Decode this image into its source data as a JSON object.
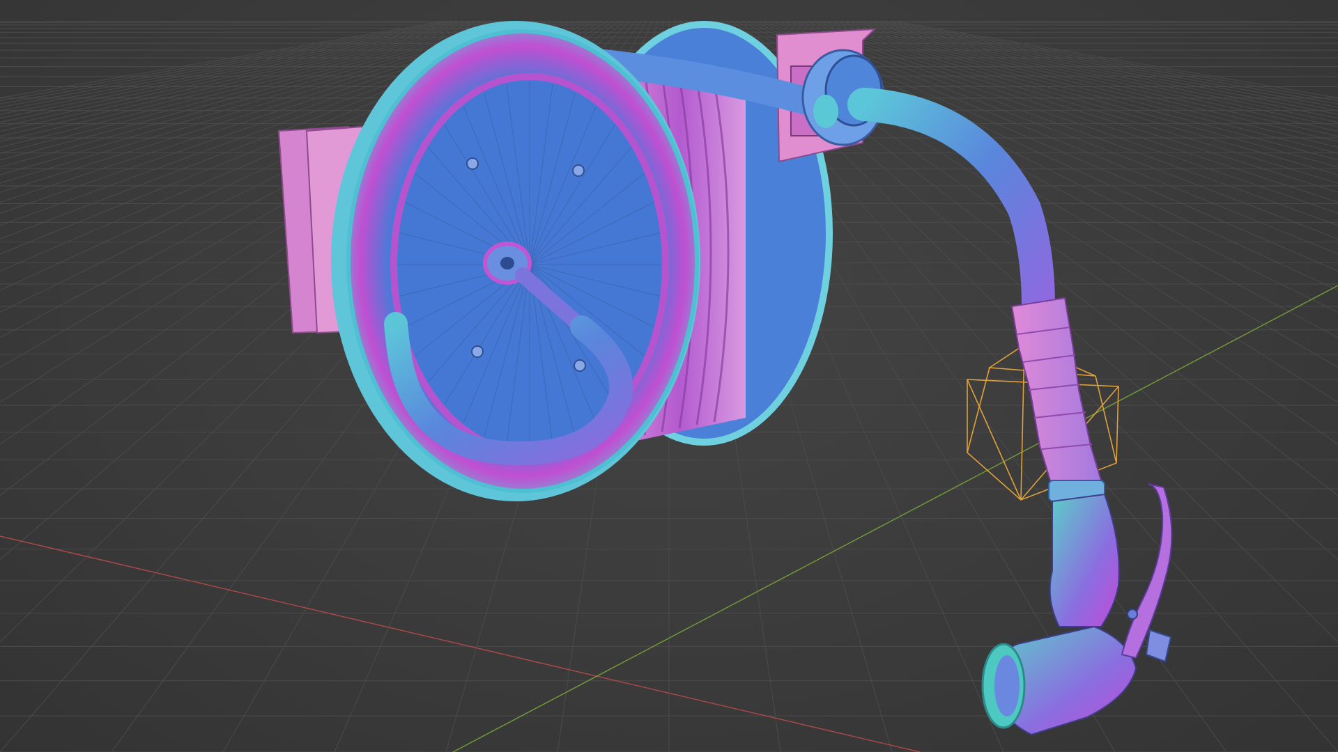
{
  "app": {
    "name": "3D Viewport",
    "shading_mode": "normal-map"
  },
  "scene": {
    "object": "hose-reel",
    "colors": {
      "background": "#3d3d3d",
      "grid": "#4a4a4a",
      "x_axis": "#b34a4a",
      "y_axis": "#7aa23a",
      "selection_outline": "#e0a23a",
      "normal_blue": "#4a7fd6",
      "normal_pink": "#d98bd9",
      "normal_cyan": "#55c8d8",
      "normal_magenta": "#c04ad0"
    }
  }
}
